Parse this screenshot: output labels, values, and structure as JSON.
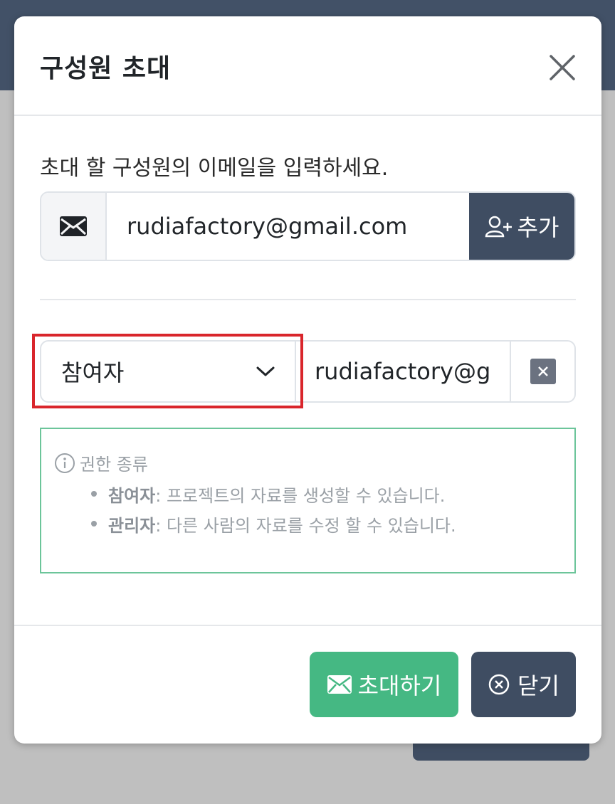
{
  "modal": {
    "title": "구성원 초대",
    "description": "초대 할 구성원의 이메일을 입력하세요.",
    "email_input": {
      "value": "rudiafactory@gmail.com",
      "prefix_icon": "envelope-icon"
    },
    "add_button": {
      "label": "추가",
      "icon": "user-plus-icon"
    },
    "member": {
      "role_selected": "참여자",
      "email": "rudiafactory@gmail.com",
      "email_visible": "rudiafactory@g"
    },
    "info": {
      "heading": "권한 종류",
      "items": [
        {
          "role": "참여자",
          "desc": " : 프로젝트의 자료를 생성할 수 있습니다."
        },
        {
          "role": "관리자",
          "desc": " : 다른 사람의 자료를 수정 할 수 있습니다."
        }
      ]
    },
    "invite_button": {
      "label": "초대하기",
      "icon": "envelope-icon"
    },
    "close_button": {
      "label": "닫기",
      "icon": "circle-x-icon"
    }
  },
  "colors": {
    "primary_dark": "#3f4d62",
    "success": "#45b883",
    "highlight": "#d9252b"
  }
}
